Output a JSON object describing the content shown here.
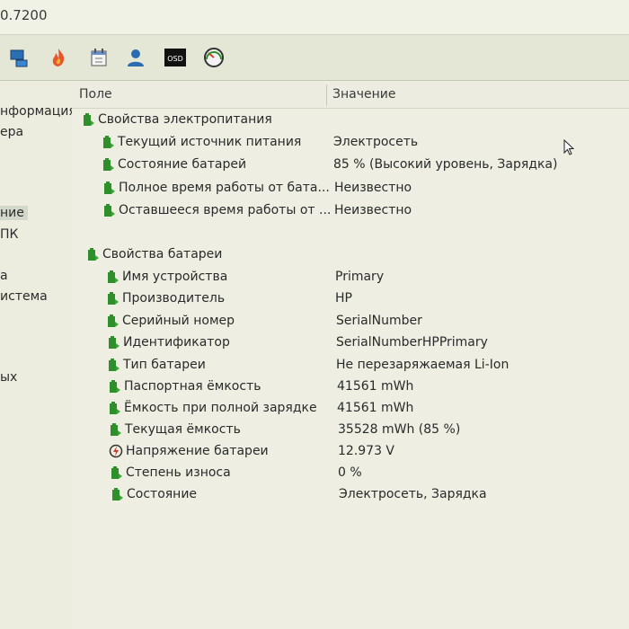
{
  "title": {
    "version_fragment": "0.7200"
  },
  "toolbar": {
    "tools": [
      {
        "icon": "network-icon"
      },
      {
        "icon": "flame-icon"
      },
      {
        "icon": "scheduler-icon"
      },
      {
        "icon": "user-icon"
      },
      {
        "icon": "osd-icon",
        "label": "OSD"
      },
      {
        "icon": "gauge-icon"
      }
    ]
  },
  "sidebar": {
    "items": [
      {
        "label": "нформация"
      },
      {
        "label": "ера"
      },
      {
        "label": "ние",
        "selected": true
      },
      {
        "label": "ПК"
      },
      {
        "label": "а"
      },
      {
        "label": "истема"
      },
      {
        "label": "ых"
      }
    ]
  },
  "table": {
    "headers": {
      "field": "Поле",
      "value": "Значение"
    },
    "groups": [
      {
        "title": "Свойства электропитания",
        "rows": [
          {
            "field": "Текущий источник питания",
            "value": "Электросеть"
          },
          {
            "field": "Состояние батарей",
            "value": "85 % (Высокий уровень, Зарядка)"
          },
          {
            "field": "Полное время работы от бата...",
            "value": "Неизвестно"
          },
          {
            "field": "Оставшееся время работы от ...",
            "value": "Неизвестно"
          }
        ]
      },
      {
        "title": "Свойства батареи",
        "rows": [
          {
            "field": "Имя устройства",
            "value": "Primary"
          },
          {
            "field": "Производитель",
            "value": "HP"
          },
          {
            "field": "Серийный номер",
            "value": "SerialNumber"
          },
          {
            "field": "Идентификатор",
            "value": "SerialNumberHPPrimary"
          },
          {
            "field": "Тип батареи",
            "value": "Не перезаряжаемая Li-Ion"
          },
          {
            "field": "Паспортная ёмкость",
            "value": "41561 mWh"
          },
          {
            "field": "Ёмкость при полной зарядке",
            "value": "41561 mWh"
          },
          {
            "field": "Текущая ёмкость",
            "value": "35528 mWh  (85 %)"
          },
          {
            "field": "Напряжение батареи",
            "value": "12.973 V",
            "icon": "voltage-icon"
          },
          {
            "field": "Степень износа",
            "value": "0 %"
          },
          {
            "field": "Состояние",
            "value": "Электросеть, Зарядка"
          }
        ]
      }
    ]
  },
  "colors": {
    "battery_green": "#2f8f2a",
    "background": "#e9ebd8",
    "selection": "#d3d8ca"
  }
}
